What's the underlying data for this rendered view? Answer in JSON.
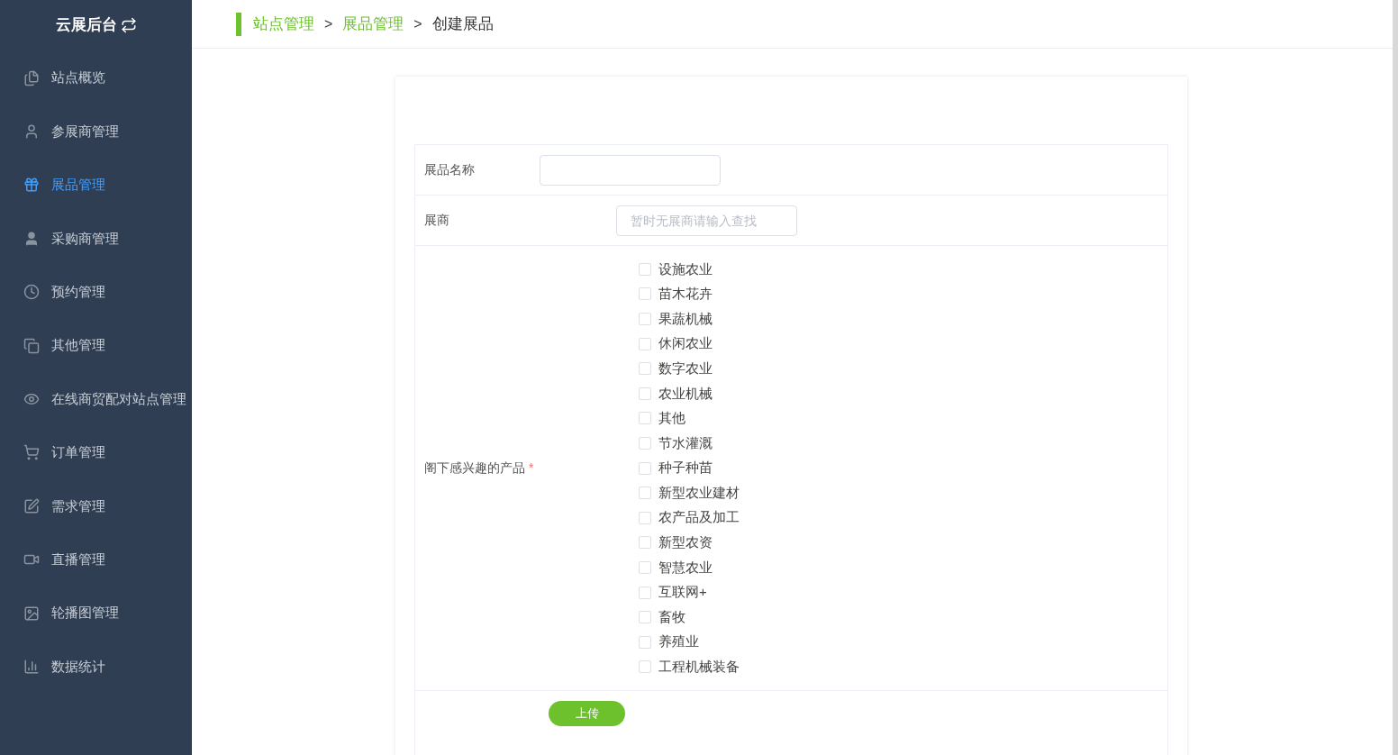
{
  "sidebar": {
    "logo": "云展后台",
    "items": [
      {
        "label": "站点概览",
        "selected": false
      },
      {
        "label": "参展商管理",
        "selected": false
      },
      {
        "label": "展品管理",
        "selected": true
      },
      {
        "label": "采购商管理",
        "selected": false
      },
      {
        "label": "预约管理",
        "selected": false
      },
      {
        "label": "其他管理",
        "selected": false
      },
      {
        "label": "在线商贸配对站点管理",
        "selected": false
      },
      {
        "label": "订单管理",
        "selected": false
      },
      {
        "label": "需求管理",
        "selected": false
      },
      {
        "label": "直播管理",
        "selected": false
      },
      {
        "label": "轮播图管理",
        "selected": false
      },
      {
        "label": "数据统计",
        "selected": false
      }
    ]
  },
  "breadcrumb": [
    {
      "label": "站点管理",
      "kind": "link"
    },
    {
      "label": "展品管理",
      "kind": "link"
    },
    {
      "label": "创建展品",
      "kind": "current"
    }
  ],
  "breadcrumb_separator": ">",
  "form": {
    "name_field": {
      "label": "展品名称"
    },
    "exhibitor_field": {
      "label": "展商",
      "placeholder": "暂时无展商请输入查找"
    },
    "interests": {
      "label": "阁下感兴趣的产品",
      "required_mark": "*",
      "options": [
        {
          "label": "设施农业",
          "checked": false
        },
        {
          "label": "苗木花卉",
          "checked": false
        },
        {
          "label": "果蔬机械",
          "checked": false
        },
        {
          "label": "休闲农业",
          "checked": false
        },
        {
          "label": "数字农业",
          "checked": false
        },
        {
          "label": "农业机械",
          "checked": false
        },
        {
          "label": "其他",
          "checked": false
        },
        {
          "label": "节水灌溉",
          "checked": false
        },
        {
          "label": "种子种苗",
          "checked": false
        },
        {
          "label": "新型农业建材",
          "checked": false
        },
        {
          "label": "农产品及加工",
          "checked": false
        },
        {
          "label": "新型农资",
          "checked": false
        },
        {
          "label": "智慧农业",
          "checked": false
        },
        {
          "label": "互联网+",
          "checked": false
        },
        {
          "label": "畜牧",
          "checked": false
        },
        {
          "label": "养殖业",
          "checked": false
        },
        {
          "label": "工程机械装备",
          "checked": false
        }
      ]
    },
    "upload_button": "上传"
  }
}
